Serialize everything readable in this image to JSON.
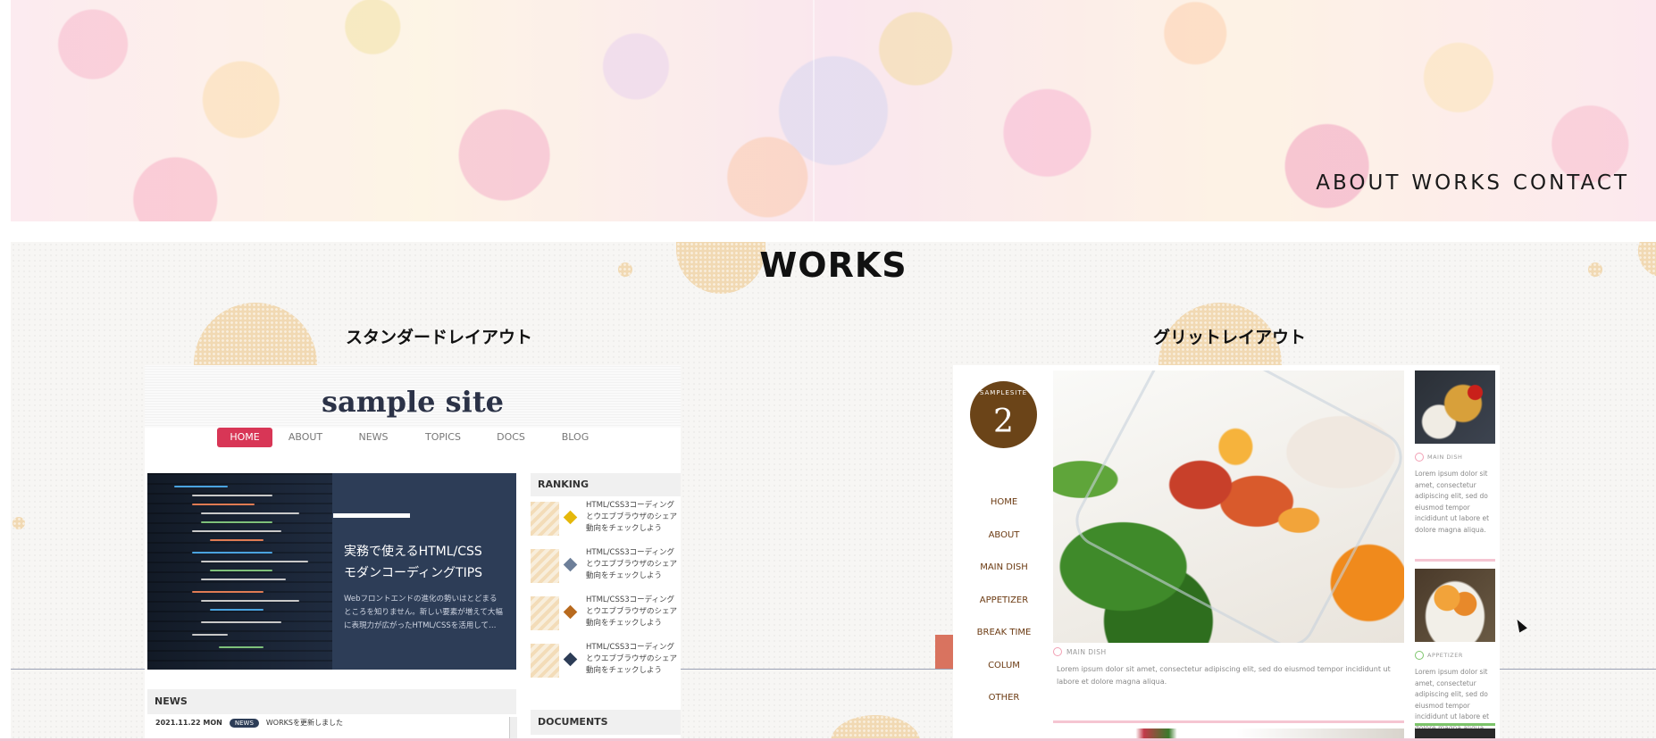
{
  "header": {
    "nav": [
      "ABOUT",
      "WORKS",
      "CONTACT"
    ]
  },
  "works": {
    "title": "WORKS",
    "layouts": [
      {
        "title": "スタンダードレイアウト",
        "site_logo": "sample site",
        "menu": [
          "HOME",
          "ABOUT",
          "NEWS",
          "TOPICS",
          "DOCS",
          "BLOG"
        ],
        "hero_title_1": "実務で使えるHTML/CSS",
        "hero_title_2": "モダンコーディングTIPS",
        "hero_text": "Webフロントエンドの進化の勢いはとどまるところを知りません。新しい要素が増えて大幅に表現力が広がったHTML/CSSを活用して…",
        "ranking_heading": "RANKING",
        "ranking_items": [
          {
            "text": "HTML/CSS3コーディングとウエブブラウザのシェア動向をチェックしよう",
            "color": "#e5b80b"
          },
          {
            "text": "HTML/CSS3コーディングとウエブブラウザのシェア動向をチェックしよう",
            "color": "#6d7f99"
          },
          {
            "text": "HTML/CSS3コーディングとウエブブラウザのシェア動向をチェックしよう",
            "color": "#b86a1e"
          },
          {
            "text": "HTML/CSS3コーディングとウエブブラウザのシェア動向をチェックしよう",
            "color": "#2d3d57"
          }
        ],
        "news_heading": "NEWS",
        "news_date": "2021.11.22 MON",
        "news_tag": "NEWS",
        "news_text": "WORKSを更新しました",
        "docs_heading": "DOCUMENTS"
      },
      {
        "title": "グリットレイアウト",
        "logo_arc": "SAMPLESITE",
        "logo_number": "2",
        "menu": [
          "HOME",
          "ABOUT",
          "MAIN DISH",
          "APPETIZER",
          "BREAK TIME",
          "COLUM",
          "OTHER"
        ],
        "main_category": "MAIN DISH",
        "main_text": "Lorem ipsum dolor sit amet, consectetur adipiscing elit, sed do eiusmod tempor incididunt ut labore et dolore magna aliqua.",
        "side_cards": [
          {
            "category": "MAIN DISH",
            "text": "Lorem ipsum dolor sit amet, consectetur adipiscing elit, sed do eiusmod tempor incididunt ut labore et dolore magna aliqua.",
            "color": "#f2a0b4"
          },
          {
            "category": "APPETIZER",
            "text": "Lorem ipsum dolor sit amet, consectetur adipiscing elit, sed do eiusmod tempor incididunt ut labore et dolore magna aliqua.",
            "color": "#7cc46a"
          }
        ]
      }
    ]
  },
  "colors": {
    "accent_pink": "#d83656",
    "navy": "#2d3d57",
    "brown": "#6b4418"
  },
  "icons": [
    "cursor-icon"
  ]
}
